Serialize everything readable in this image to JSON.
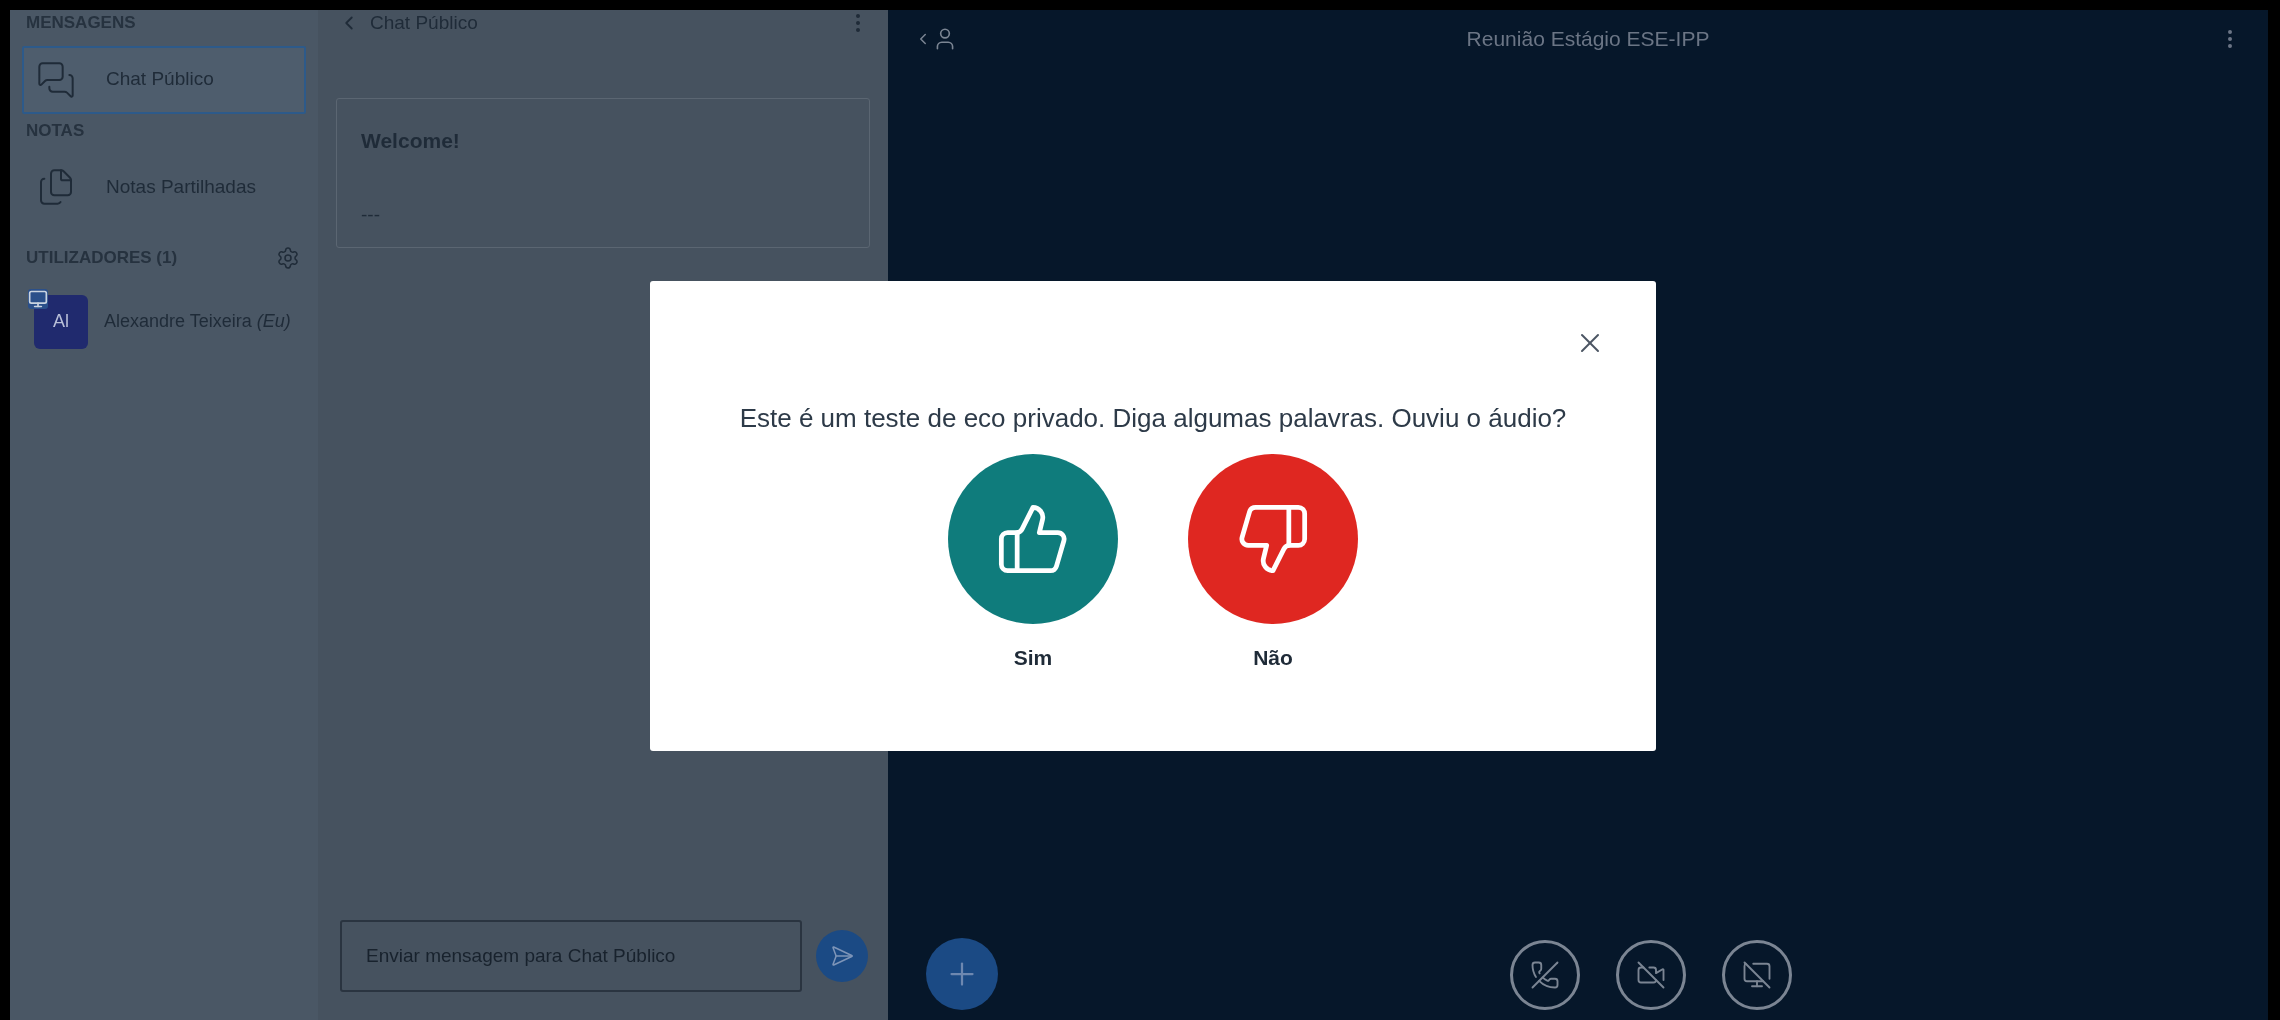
{
  "sidebar": {
    "sections": [
      {
        "heading": "MENSAGENS",
        "items": [
          {
            "label": "Chat Público",
            "kind": "chat",
            "selected": true
          }
        ]
      },
      {
        "heading": "NOTAS",
        "items": [
          {
            "label": "Notas Partilhadas",
            "kind": "notes",
            "selected": false
          }
        ]
      }
    ],
    "users_heading": "UTILIZADORES (1)",
    "users": [
      {
        "initials": "Al",
        "name": "Alexandre Teixeira",
        "suffix": "(Eu)"
      }
    ]
  },
  "chat": {
    "title": "Chat Público",
    "messages": [
      {
        "title": "Welcome!",
        "body": "---"
      }
    ],
    "input": {
      "placeholder": "Enviar mensagem para Chat Público"
    }
  },
  "meeting": {
    "title": "Reunião Estágio ESE-IPP"
  },
  "dialog": {
    "prompt": "Este é um teste de eco privado. Diga algumas palavras. Ouviu o áudio?",
    "options": [
      {
        "label": "Sim",
        "kind": "yes"
      },
      {
        "label": "Não",
        "kind": "no"
      }
    ]
  },
  "controls": [
    {
      "kind": "audio"
    },
    {
      "kind": "video"
    },
    {
      "kind": "screen"
    }
  ]
}
